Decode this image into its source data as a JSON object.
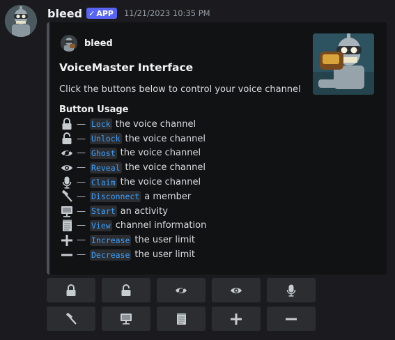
{
  "message": {
    "username": "bleed",
    "badge": "APP",
    "badge_check": "✓",
    "timestamp": "11/21/2023 10:35 PM"
  },
  "embed": {
    "author": "bleed",
    "title": "VoiceMaster Interface",
    "description": "Click the buttons below to control your voice channel",
    "usage_title": "Button Usage",
    "dash": "—",
    "usage": [
      {
        "icon": "lock-icon",
        "command": "Lock",
        "text": "the voice channel"
      },
      {
        "icon": "unlock-icon",
        "command": "Unlock",
        "text": "the voice channel"
      },
      {
        "icon": "ghost-eye-icon",
        "command": "Ghost",
        "text": "the voice channel"
      },
      {
        "icon": "eye-icon",
        "command": "Reveal",
        "text": "the voice channel"
      },
      {
        "icon": "microphone-icon",
        "command": "Claim",
        "text": "the voice channel"
      },
      {
        "icon": "hammer-icon",
        "command": "Disconnect",
        "text": "a member"
      },
      {
        "icon": "monitor-icon",
        "command": "Start",
        "text": "an activity"
      },
      {
        "icon": "notepad-icon",
        "command": "View",
        "text": "channel information"
      },
      {
        "icon": "plus-icon",
        "command": "Increase",
        "text": "the user limit"
      },
      {
        "icon": "minus-icon",
        "command": "Decrease",
        "text": "the user limit"
      }
    ]
  },
  "buttons": [
    [
      "lock-icon",
      "unlock-icon",
      "ghost-eye-icon",
      "eye-icon",
      "microphone-icon"
    ],
    [
      "hammer-icon",
      "monitor-icon",
      "notepad-icon",
      "plus-icon",
      "minus-icon"
    ]
  ],
  "colors": {
    "background": "#1b1b1f",
    "embed_bg": "#111214",
    "embed_border": "#4e5058",
    "button_bg": "#2b2d31",
    "code_text": "#3aa0ff",
    "badge": "#5865f2",
    "icon": "#c7ccd1"
  }
}
